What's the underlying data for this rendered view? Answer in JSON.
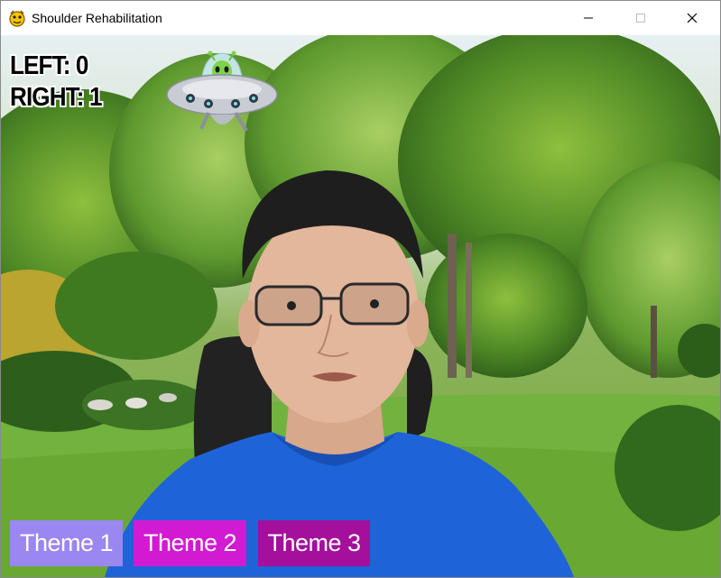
{
  "window": {
    "title": "Shoulder Rehabilitation",
    "app_icon": "pygame-snake-icon",
    "controls": [
      "minimize-icon",
      "maximize-icon",
      "close-icon"
    ]
  },
  "scores": {
    "left": "LEFT: 0",
    "right": "RIGHT: 1"
  },
  "sprite": "ufo-alien-icon",
  "background": "park-with-trees-and-lawn",
  "themes": [
    {
      "label": "Theme 1",
      "color": "#9a87f0"
    },
    {
      "label": "Theme 2",
      "color": "#d21ad2"
    },
    {
      "label": "Theme 3",
      "color": "#a40f9c"
    }
  ]
}
